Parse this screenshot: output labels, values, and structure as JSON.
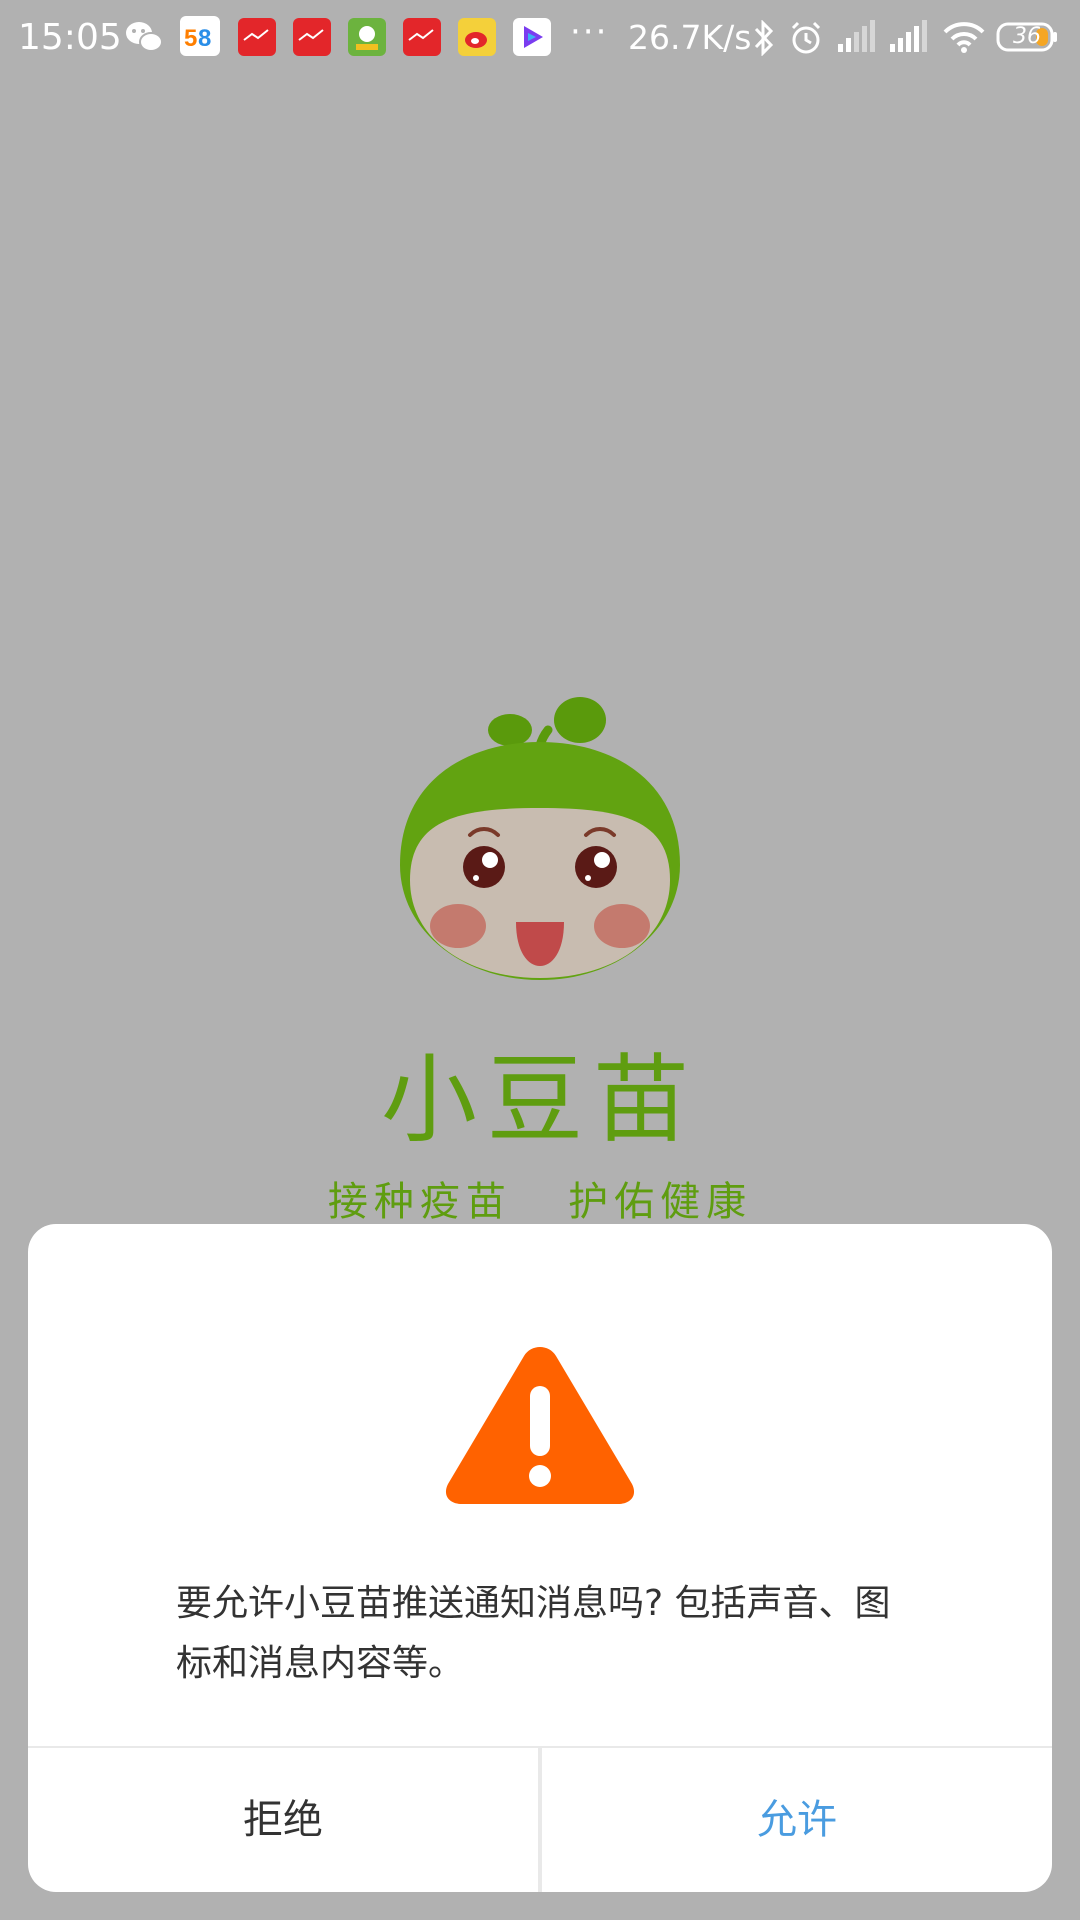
{
  "status_bar": {
    "time": "15:05",
    "dots": "···",
    "network_speed": "26.7K/s",
    "battery_level": "36",
    "notification_icons": [
      "wechat-icon",
      "58-app-icon",
      "red-app-icon",
      "red-app-icon",
      "game-app-icon",
      "red-app-icon",
      "weibo-icon",
      "video-app-icon"
    ],
    "status_icons": [
      "bluetooth-icon",
      "alarm-icon",
      "signal-icon",
      "signal-icon",
      "wifi-icon",
      "battery-icon"
    ]
  },
  "splash": {
    "app_name": "小豆苗",
    "slogan": "接种疫苗   护佑健康",
    "brand_color": "#5f9d10"
  },
  "dialog": {
    "icon": "warning-icon",
    "icon_color": "#ff6200",
    "message": "要允许小豆苗推送通知消息吗? 包括声音、图标和消息内容等。",
    "deny_label": "拒绝",
    "allow_label": "允许",
    "allow_color": "#4a9ce0"
  }
}
